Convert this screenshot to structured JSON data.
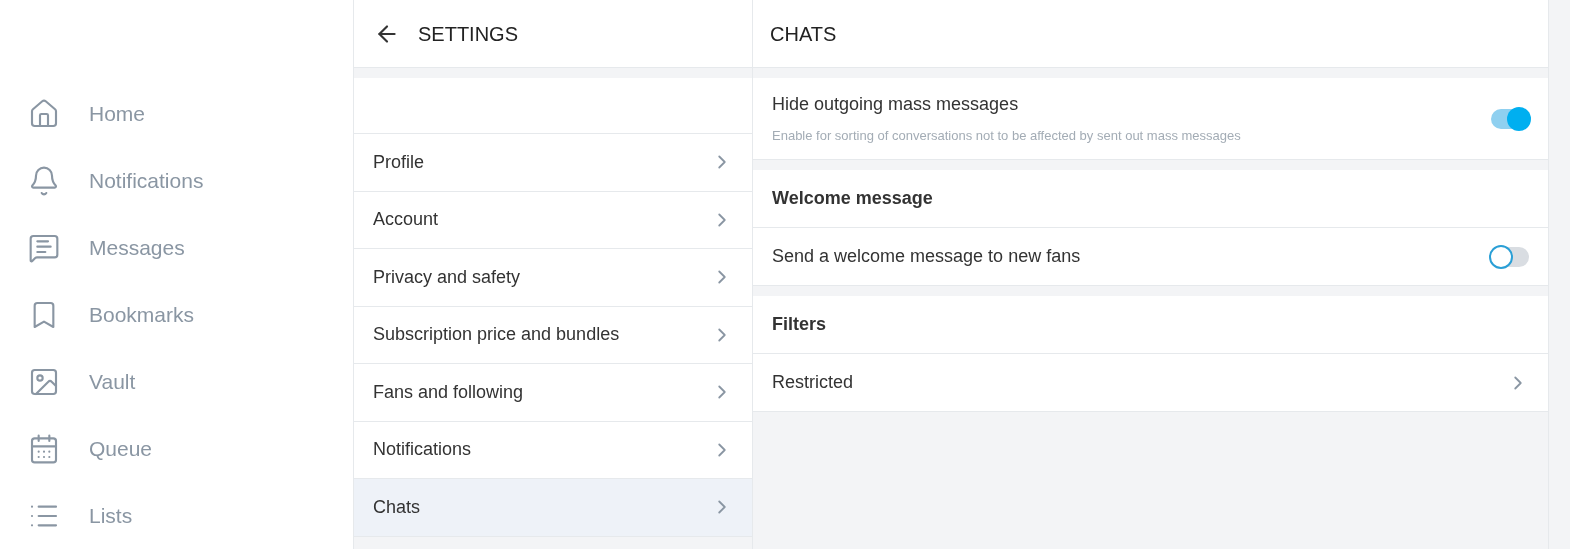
{
  "nav": [
    {
      "label": "Home"
    },
    {
      "label": "Notifications"
    },
    {
      "label": "Messages"
    },
    {
      "label": "Bookmarks"
    },
    {
      "label": "Vault"
    },
    {
      "label": "Queue"
    },
    {
      "label": "Lists"
    }
  ],
  "settings": {
    "title": "SETTINGS",
    "items": [
      {
        "label": "Profile",
        "selected": false
      },
      {
        "label": "Account",
        "selected": false
      },
      {
        "label": "Privacy and safety",
        "selected": false
      },
      {
        "label": "Subscription price and bundles",
        "selected": false
      },
      {
        "label": "Fans and following",
        "selected": false
      },
      {
        "label": "Notifications",
        "selected": false
      },
      {
        "label": "Chats",
        "selected": true
      }
    ]
  },
  "chats": {
    "title": "CHATS",
    "sections": [
      {
        "rows": [
          {
            "kind": "toggle",
            "label": "Hide outgoing mass messages",
            "description": "Enable for sorting of conversations not to be affected by sent out mass messages",
            "on": true
          }
        ]
      },
      {
        "heading": "Welcome message",
        "rows": [
          {
            "kind": "toggle",
            "label": "Send a welcome message to new fans",
            "on": false
          }
        ]
      },
      {
        "heading": "Filters",
        "rows": [
          {
            "kind": "link",
            "label": "Restricted"
          }
        ]
      }
    ]
  }
}
